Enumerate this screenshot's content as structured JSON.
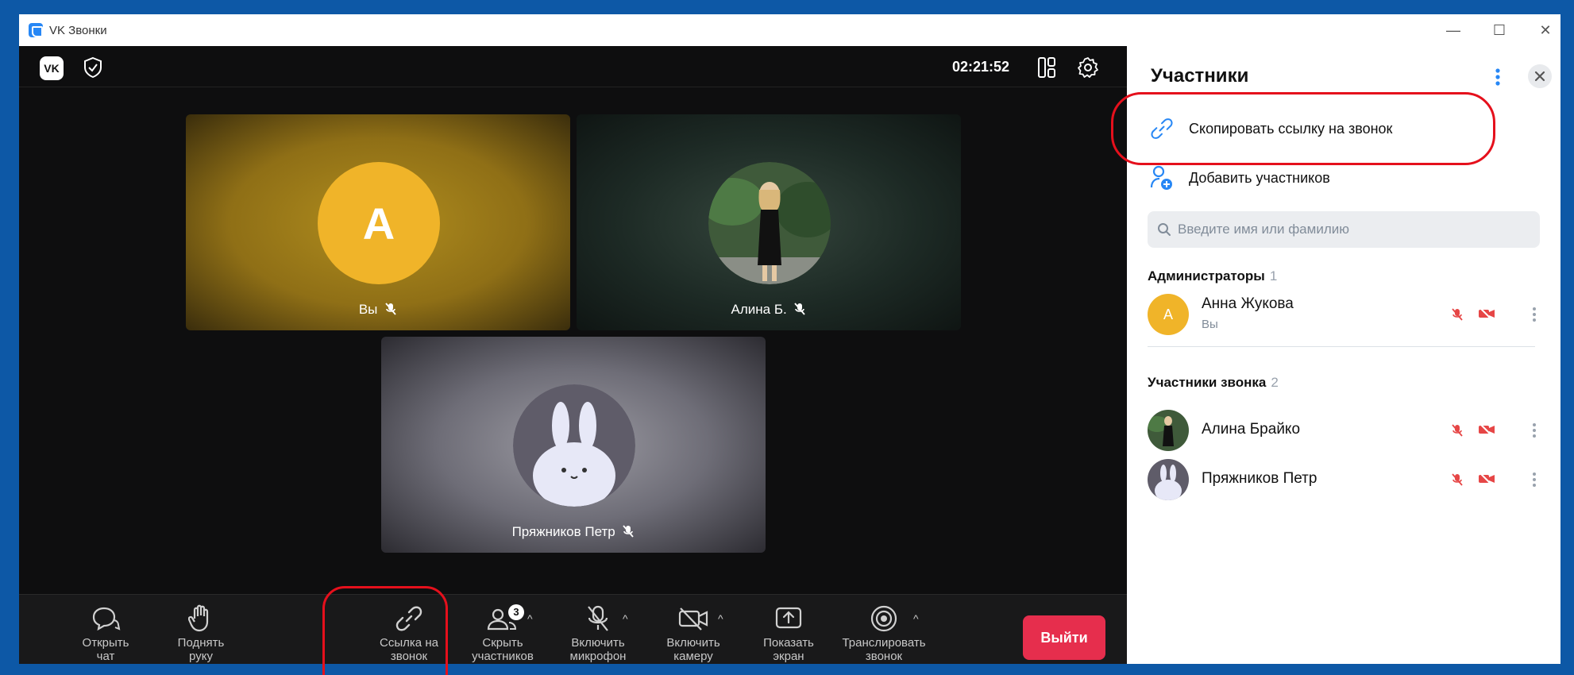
{
  "window": {
    "title": "VK Звонки",
    "controls": {
      "minimize": "—",
      "maximize": "☐",
      "close": "✕"
    }
  },
  "topbar": {
    "logo_text": "VK",
    "timer": "02:21:52"
  },
  "tiles": [
    {
      "label": "Вы",
      "avatar_letter": "A",
      "avatar_color": "#f0b429"
    },
    {
      "label": "Алина Б."
    },
    {
      "label": "Пряжников Петр"
    }
  ],
  "controls": {
    "chat": "Открыть чат",
    "hand": "Поднять руку",
    "link": "Ссылка на звонок",
    "participants": "Скрыть участников",
    "participants_badge": "3",
    "mic": "Включить микрофон",
    "camera": "Включить камеру",
    "screen": "Показать экран",
    "broadcast": "Транслировать звонок",
    "exit": "Выйти"
  },
  "panel": {
    "title": "Участники",
    "copy_link": "Скопировать ссылку на звонок",
    "add_participants": "Добавить участников",
    "search_placeholder": "Введите имя или фамилию",
    "admins": {
      "heading": "Администраторы",
      "count": "1",
      "members": [
        {
          "name": "Анна Жукова",
          "sub": "Вы",
          "avatar_letter": "А"
        }
      ]
    },
    "participants": {
      "heading": "Участники звонка",
      "count": "2",
      "members": [
        {
          "name": "Алина Брайко"
        },
        {
          "name": "Пряжников Петр"
        }
      ]
    }
  },
  "colors": {
    "accent": "#2787f5",
    "exit": "#e62e4d",
    "muted_red": "#e64646",
    "highlight": "#e5101c"
  }
}
